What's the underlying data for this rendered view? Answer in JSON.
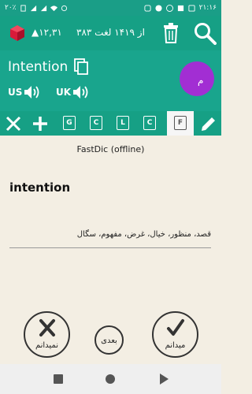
{
  "status": {
    "time": "۲۱:۱۶",
    "battery": "۲۰٪"
  },
  "header": {
    "score": "▲۱۲,۳۱",
    "progress": "۳۸۳ از ۱۴۱۹ لغت"
  },
  "word": {
    "text": "Intention",
    "us_label": "US",
    "uk_label": "UK",
    "avatar_letter": "م"
  },
  "toolbar": {
    "filters": [
      "G",
      "C",
      "L",
      "C",
      "F"
    ]
  },
  "dictionary": {
    "source": "FastDic (offline)",
    "entry": "intention",
    "meaning": "قصد، منظور، خیال، غرض، مفهوم، سگال"
  },
  "actions": {
    "dont_know": "نمیدانم",
    "next": "بعدی",
    "know": "میدانم"
  },
  "colors": {
    "primary": "#16a085",
    "avatar": "#a22ed3",
    "background": "#f3eee3"
  }
}
